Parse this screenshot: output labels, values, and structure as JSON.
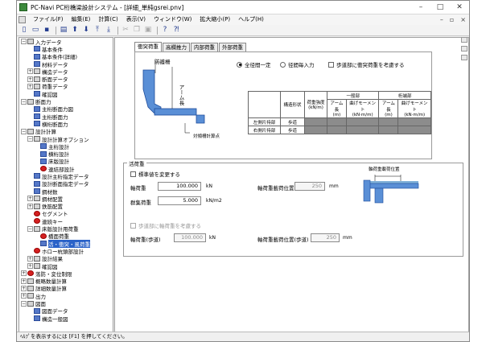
{
  "window": {
    "title": "PC-Navi PC桁橋梁設計システム - [詳細_単純gsrei.pnv]"
  },
  "menu": [
    "ファイル(F)",
    "編集(E)",
    "計算(C)",
    "表示(V)",
    "ウィンドウ(W)",
    "拡大縮小(P)",
    "ヘルプ(H)"
  ],
  "tree": [
    {
      "g": "−",
      "icon": "folder",
      "label": "入力データ",
      "indent": 0
    },
    {
      "g": "",
      "icon": "doc",
      "label": "基本条件",
      "indent": 1
    },
    {
      "g": "",
      "icon": "doc",
      "label": "基本条件(詳細)",
      "indent": 1
    },
    {
      "g": "",
      "icon": "doc",
      "label": "材料データ",
      "indent": 1
    },
    {
      "g": "+",
      "icon": "folder",
      "label": "構造データ",
      "indent": 1
    },
    {
      "g": "+",
      "icon": "folder",
      "label": "断面データ",
      "indent": 1
    },
    {
      "g": "+",
      "icon": "folder",
      "label": "荷重データ",
      "indent": 1
    },
    {
      "g": "",
      "icon": "doc",
      "label": "確認図",
      "indent": 1
    },
    {
      "g": "−",
      "icon": "folder",
      "label": "断面力",
      "indent": 0
    },
    {
      "g": "",
      "icon": "doc",
      "label": "主桁断面力図",
      "indent": 1
    },
    {
      "g": "",
      "icon": "doc",
      "label": "主桁断面力",
      "indent": 1
    },
    {
      "g": "",
      "icon": "doc",
      "label": "横桁断面力",
      "indent": 1
    },
    {
      "g": "−",
      "icon": "folder",
      "label": "設計計算",
      "indent": 0
    },
    {
      "g": "−",
      "icon": "folder",
      "label": "設計計算オプション",
      "indent": 1
    },
    {
      "g": "",
      "icon": "doc",
      "label": "主桁設計",
      "indent": 2
    },
    {
      "g": "",
      "icon": "doc",
      "label": "横桁設計",
      "indent": 2
    },
    {
      "g": "",
      "icon": "doc",
      "label": "床版設計",
      "indent": 2
    },
    {
      "g": "",
      "icon": "red",
      "label": "連結部設計",
      "indent": 2
    },
    {
      "g": "",
      "icon": "doc",
      "label": "設計主桁指定データ",
      "indent": 1
    },
    {
      "g": "",
      "icon": "doc",
      "label": "設計断面指定データ",
      "indent": 1
    },
    {
      "g": "",
      "icon": "doc",
      "label": "鋼材数",
      "indent": 1
    },
    {
      "g": "+",
      "icon": "folder",
      "label": "鋼材配置",
      "indent": 1
    },
    {
      "g": "+",
      "icon": "folder",
      "label": "鉄筋配置",
      "indent": 1
    },
    {
      "g": "",
      "icon": "red",
      "label": "セグメント",
      "indent": 1
    },
    {
      "g": "",
      "icon": "red",
      "label": "連続キー",
      "indent": 1
    },
    {
      "g": "−",
      "icon": "folder",
      "label": "床版設計用荷重",
      "indent": 1
    },
    {
      "g": "",
      "icon": "red",
      "label": "橋面荷重",
      "indent": 2
    },
    {
      "g": "",
      "icon": "doc",
      "label": "活・衝突・風荷重",
      "indent": 2,
      "sel": true
    },
    {
      "g": "",
      "icon": "red",
      "label": "ホロー杭頭部設計",
      "indent": 1
    },
    {
      "g": "+",
      "icon": "folder",
      "label": "設計結果",
      "indent": 1
    },
    {
      "g": "+",
      "icon": "folder",
      "label": "確認図",
      "indent": 1
    },
    {
      "g": "+",
      "icon": "red",
      "label": "落防・変位制限",
      "indent": 0
    },
    {
      "g": "+",
      "icon": "folder",
      "label": "概略数量計算",
      "indent": 0
    },
    {
      "g": "+",
      "icon": "folder",
      "label": "詳細数量計算",
      "indent": 0
    },
    {
      "g": "+",
      "icon": "folder",
      "label": "出力",
      "indent": 0
    },
    {
      "g": "−",
      "icon": "folder",
      "label": "図面",
      "indent": 0
    },
    {
      "g": "",
      "icon": "doc",
      "label": "図面データ",
      "indent": 1
    },
    {
      "g": "",
      "icon": "doc",
      "label": "構造一般図",
      "indent": 1
    }
  ],
  "tabs": [
    "衝突荷重",
    "高欄推力",
    "内部荷重",
    "外部荷重"
  ],
  "impact": {
    "radio_all": "全径間一定",
    "radio_each": "径間毎入力",
    "check_walkway": "歩道部に衝突荷重を考慮する",
    "fig_guard": "防護柵",
    "fig_arm": "アーム長",
    "fig_calc": "対傾柵計算点",
    "col_shape": "構造形状",
    "col_load": "荷重強度",
    "col_load_unit": "(kN/m)",
    "col_general": "一般部",
    "col_bracket": "桁端部",
    "col_arm": "アーム長",
    "col_arm_unit": "(m)",
    "col_moment": "曲げモーメント",
    "col_moment_unit": "(kN·m/m)",
    "row_left": "左側片持部",
    "row_right": "右側片持部",
    "shape_left": "歩道",
    "shape_right": "歩道"
  },
  "live": {
    "group": "活荷重",
    "check_std": "標準値を変更する",
    "axle_label": "軸荷重",
    "axle_value": "100.000",
    "axle_unit": "kN",
    "dist_label": "群集荷重",
    "dist_value": "5.000",
    "dist_unit": "kN/m2",
    "pos_label": "軸荷重載荷位置",
    "pos_value": "250",
    "pos_unit": "mm",
    "fig_label": "軸荷重載荷位置",
    "check_walk": "歩道部に軸荷重を考慮する",
    "walk_axle_label": "軸荷重(歩道)",
    "walk_axle_value": "100.000",
    "walk_axle_unit": "kN",
    "walk_pos_label": "軸荷重載荷位置(歩道)",
    "walk_pos_value": "250",
    "walk_pos_unit": "mm"
  },
  "status": "ﾍﾙﾌﾟを表示するには [F1] を押してください。"
}
